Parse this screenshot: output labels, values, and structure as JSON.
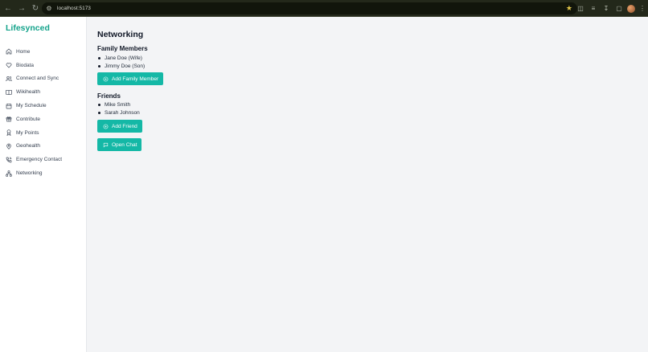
{
  "browser": {
    "url": "localhost:5173"
  },
  "sidebar": {
    "brand": "Lifesynced",
    "items": [
      {
        "label": "Home",
        "icon": "home-icon"
      },
      {
        "label": "Biodata",
        "icon": "heart-icon"
      },
      {
        "label": "Connect and Sync",
        "icon": "users-icon"
      },
      {
        "label": "Wikihealth",
        "icon": "book-icon"
      },
      {
        "label": "My Schedule",
        "icon": "calendar-icon"
      },
      {
        "label": "Contribute",
        "icon": "gift-icon"
      },
      {
        "label": "My Points",
        "icon": "award-icon"
      },
      {
        "label": "Geohealth",
        "icon": "map-pin-icon"
      },
      {
        "label": "Emergency Contact",
        "icon": "phone-icon"
      },
      {
        "label": "Networking",
        "icon": "network-icon"
      }
    ]
  },
  "main": {
    "title": "Networking",
    "family": {
      "heading": "Family Members",
      "members": [
        "Jane Doe (Wife)",
        "Jimmy Doe (Son)"
      ],
      "add_button": "Add Family Member"
    },
    "friends": {
      "heading": "Friends",
      "members": [
        "Mike Smith",
        "Sarah Johnson"
      ],
      "add_button": "Add Friend"
    },
    "chat_button": "Open Chat"
  },
  "colors": {
    "accent": "#14b8a6",
    "brand": "#14a38b",
    "background": "#f3f4f6"
  }
}
